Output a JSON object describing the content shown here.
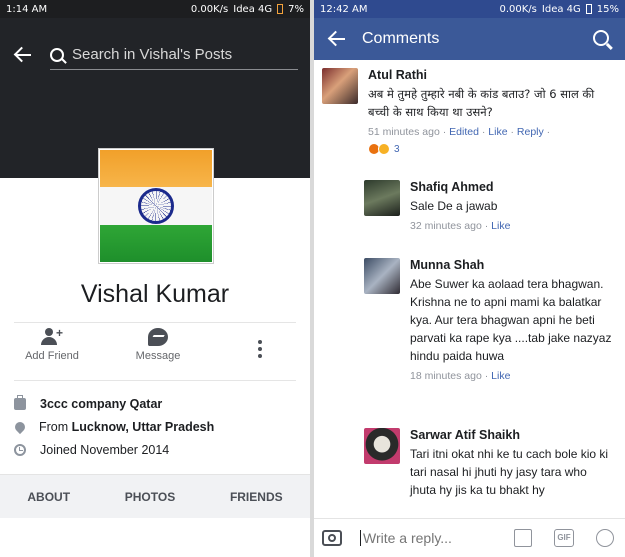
{
  "left": {
    "status": {
      "time": "1:14 AM",
      "speed": "0.00K/s",
      "network": "Idea 4G",
      "battery": "7%"
    },
    "search": {
      "placeholder": "Search in Vishal's Posts"
    },
    "profile": {
      "name": "Vishal Kumar"
    },
    "actions": {
      "add_friend": "Add Friend",
      "message": "Message"
    },
    "info": {
      "work": "3ccc company Qatar",
      "from_prefix": "From ",
      "from_place": "Lucknow, Uttar Pradesh",
      "joined": "Joined November 2014"
    },
    "tabs": [
      "ABOUT",
      "PHOTOS",
      "FRIENDS"
    ]
  },
  "right": {
    "status": {
      "time": "12:42 AM",
      "speed": "0.00K/s",
      "network": "Idea 4G",
      "battery": "15%"
    },
    "appbar": {
      "title": "Comments"
    },
    "comments": [
      {
        "name": "Atul Rathi",
        "text": "अब मे तुमहे तुम्हारे नबी के कांड बताउ?  जो 6 साल की बच्ची के साथ किया था उसने?",
        "time": "51 minutes ago",
        "edited": "Edited",
        "like": "Like",
        "reply": "Reply",
        "reaction_count": "3"
      },
      {
        "name": "Shafiq Ahmed",
        "text": "Sale De a jawab",
        "time": "32 minutes ago",
        "like": "Like"
      },
      {
        "name": "Munna Shah",
        "text": "Abe Suwer ka aolaad tera bhagwan. Krishna ne to apni mami ka balatkar kya. Aur tera bhagwan apni he beti parvati ka rape kya ....tab jake nazyaz hindu paida huwa",
        "time": "18 minutes ago",
        "like": "Like"
      },
      {
        "name": "Sarwar Atif Shaikh",
        "text": "Tari itni okat nhi ke tu cach bole kio ki tari nasal hi jhuti hy jasy tara who jhuta hy jis ka tu bhakt hy"
      }
    ],
    "composer": {
      "placeholder": "Write a reply...",
      "gif": "GIF"
    }
  },
  "colors": {
    "facebook_blue": "#3b5998",
    "link_blue": "#4267b2",
    "meta_gray": "#90949c"
  }
}
